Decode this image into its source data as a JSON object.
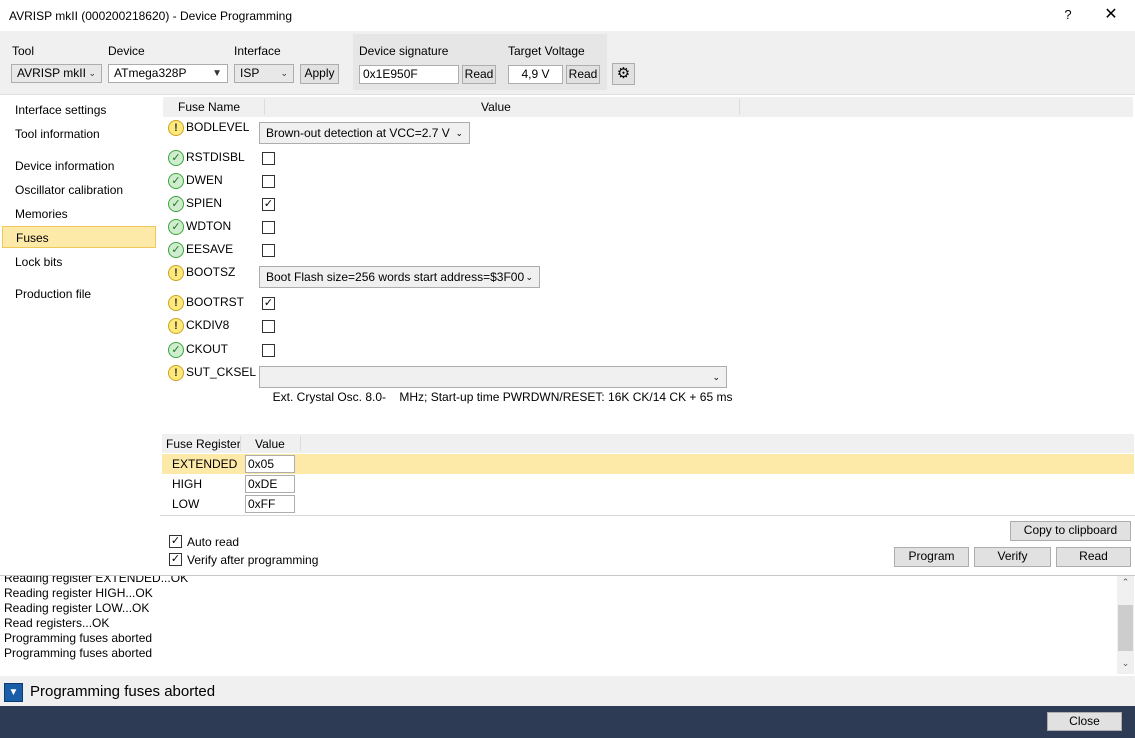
{
  "window": {
    "title": "AVRISP mkII (000200218620) - Device Programming",
    "help": "?",
    "close": "✕"
  },
  "toolbar": {
    "tool_label": "Tool",
    "tool_value": "AVRISP mkII",
    "device_label": "Device",
    "device_value": "ATmega328P",
    "interface_label": "Interface",
    "interface_value": "ISP",
    "apply": "Apply",
    "signature_label": "Device signature",
    "signature_value": "0x1E950F",
    "signature_read": "Read",
    "voltage_label": "Target Voltage",
    "voltage_value": "4,9 V",
    "voltage_read": "Read"
  },
  "nav": {
    "items": [
      {
        "label": "Interface settings"
      },
      {
        "label": "Tool information"
      },
      {
        "label": "Device information"
      },
      {
        "label": "Oscillator calibration"
      },
      {
        "label": "Memories"
      },
      {
        "label": "Fuses"
      },
      {
        "label": "Lock bits"
      },
      {
        "label": "Production file"
      }
    ],
    "selected": "Fuses"
  },
  "fuses": {
    "col_name": "Fuse Name",
    "col_value": "Value",
    "rows": [
      {
        "name": "BODLEVEL",
        "status": "warn",
        "kind": "combo",
        "value": "Brown-out detection at VCC=2.7 V"
      },
      {
        "name": "RSTDISBL",
        "status": "ok",
        "kind": "check",
        "checked": false
      },
      {
        "name": "DWEN",
        "status": "ok",
        "kind": "check",
        "checked": false
      },
      {
        "name": "SPIEN",
        "status": "ok",
        "kind": "check",
        "checked": true
      },
      {
        "name": "WDTON",
        "status": "ok",
        "kind": "check",
        "checked": false
      },
      {
        "name": "EESAVE",
        "status": "ok",
        "kind": "check",
        "checked": false
      },
      {
        "name": "BOOTSZ",
        "status": "warn",
        "kind": "combo",
        "value": "Boot Flash size=256 words start address=$3F00"
      },
      {
        "name": "BOOTRST",
        "status": "warn",
        "kind": "check",
        "checked": true
      },
      {
        "name": "CKDIV8",
        "status": "warn",
        "kind": "check",
        "checked": false
      },
      {
        "name": "CKOUT",
        "status": "ok",
        "kind": "check",
        "checked": false
      },
      {
        "name": "SUT_CKSEL",
        "status": "warn",
        "kind": "combo",
        "value": "Ext. Crystal Osc. 8.0-    MHz; Start-up time PWRDWN/RESET: 16K CK/14 CK + 65 ms"
      }
    ]
  },
  "registers": {
    "col_name": "Fuse Register",
    "col_value": "Value",
    "rows": [
      {
        "name": "EXTENDED",
        "value": "0x05"
      },
      {
        "name": "HIGH",
        "value": "0xDE"
      },
      {
        "name": "LOW",
        "value": "0xFF"
      }
    ]
  },
  "options": {
    "auto_read": "Auto read",
    "auto_read_checked": true,
    "verify_after": "Verify after programming",
    "verify_after_checked": true,
    "copy_clipboard": "Copy to clipboard",
    "program": "Program",
    "verify": "Verify",
    "read": "Read"
  },
  "log": {
    "lines": [
      "Reading register EXTENDED...OK",
      "Reading register HIGH...OK",
      "Reading register LOW...OK",
      "Read registers...OK",
      "Programming fuses aborted",
      "Programming fuses aborted"
    ]
  },
  "status": {
    "text": "Programming fuses aborted",
    "toggle": "▼"
  },
  "footer": {
    "close": "Close"
  },
  "colors": {
    "selection": "#fde9a8",
    "footer": "#2d3b55",
    "status_toggle": "#1a5ea8"
  },
  "icons": {
    "warn": "!",
    "ok": "✓",
    "check": "✓",
    "arrow": "⌄"
  }
}
